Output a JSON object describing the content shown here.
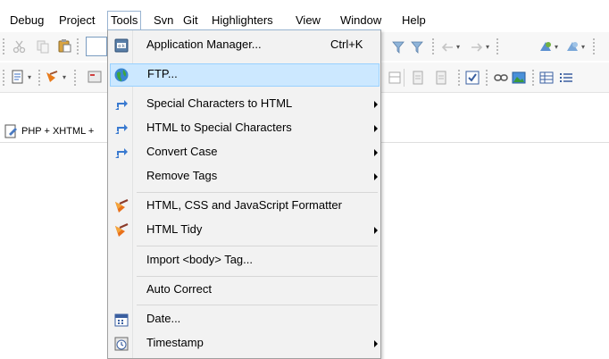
{
  "menubar": {
    "items": [
      {
        "label": "Debug"
      },
      {
        "label": "Project"
      },
      {
        "label": "Tools"
      },
      {
        "label": "Svn"
      },
      {
        "label": "Git"
      },
      {
        "label": "Highlighters"
      },
      {
        "label": "View"
      },
      {
        "label": "Window"
      },
      {
        "label": "Help"
      }
    ]
  },
  "tab": {
    "label": "PHP + XHTML +"
  },
  "tools_menu": {
    "items": [
      {
        "label": "Application Manager...",
        "shortcut": "Ctrl+K",
        "submenu": false,
        "icon": "application-manager-icon"
      },
      {
        "label": "FTP...",
        "shortcut": "",
        "submenu": false,
        "icon": "globe-icon",
        "highlighted": true
      },
      {
        "label": "Special Characters to HTML",
        "shortcut": "",
        "submenu": true,
        "icon": "convert-arrows-icon"
      },
      {
        "label": "HTML to Special Characters",
        "shortcut": "",
        "submenu": true,
        "icon": "convert-arrows-icon"
      },
      {
        "label": "Convert Case",
        "shortcut": "",
        "submenu": true,
        "icon": "convert-arrows-icon"
      },
      {
        "label": "Remove Tags",
        "shortcut": "",
        "submenu": true,
        "icon": ""
      },
      {
        "label": "HTML, CSS and JavaScript Formatter",
        "shortcut": "",
        "submenu": false,
        "icon": "broom-icon"
      },
      {
        "label": "HTML Tidy",
        "shortcut": "",
        "submenu": true,
        "icon": "broom-icon"
      },
      {
        "label": "Import <body> Tag...",
        "shortcut": "",
        "submenu": false,
        "icon": ""
      },
      {
        "label": "Auto Correct",
        "shortcut": "",
        "submenu": false,
        "icon": ""
      },
      {
        "label": "Date...",
        "shortcut": "",
        "submenu": false,
        "icon": "calendar-icon"
      },
      {
        "label": "Timestamp",
        "shortcut": "",
        "submenu": true,
        "icon": "clock-icon"
      }
    ]
  },
  "colors": {
    "highlight_bg": "#cce8ff",
    "highlight_border": "#99d1ff",
    "menu_bg": "#f2f2f2",
    "toolbar_bg": "#f7f7f7"
  }
}
